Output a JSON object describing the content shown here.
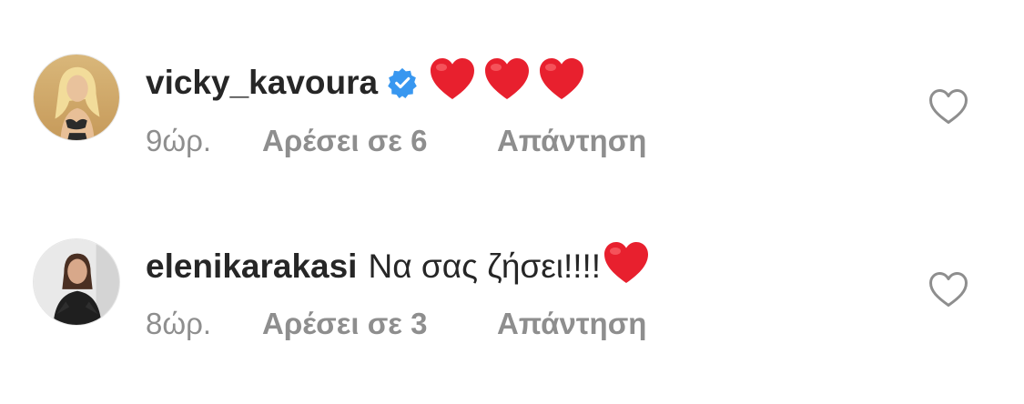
{
  "comments": [
    {
      "username": "vicky_kavoura",
      "verified": true,
      "text": "",
      "emoji": [
        "red-heart",
        "red-heart",
        "red-heart"
      ],
      "time": "9ώρ.",
      "likes": "Αρέσει σε 6",
      "reply": "Απάντηση"
    },
    {
      "username": "elenikarakasi",
      "verified": false,
      "text": "Να σας ζήσει!!!!",
      "emoji": [
        "red-heart"
      ],
      "time": "8ώρ.",
      "likes": "Αρέσει σε 3",
      "reply": "Απάντηση"
    }
  ],
  "colors": {
    "text_primary": "#262626",
    "text_secondary": "#8e8e8e",
    "verified_blue": "#3897f0",
    "heart_red": "#e8202e",
    "like_outline": "#8e8e8e"
  }
}
